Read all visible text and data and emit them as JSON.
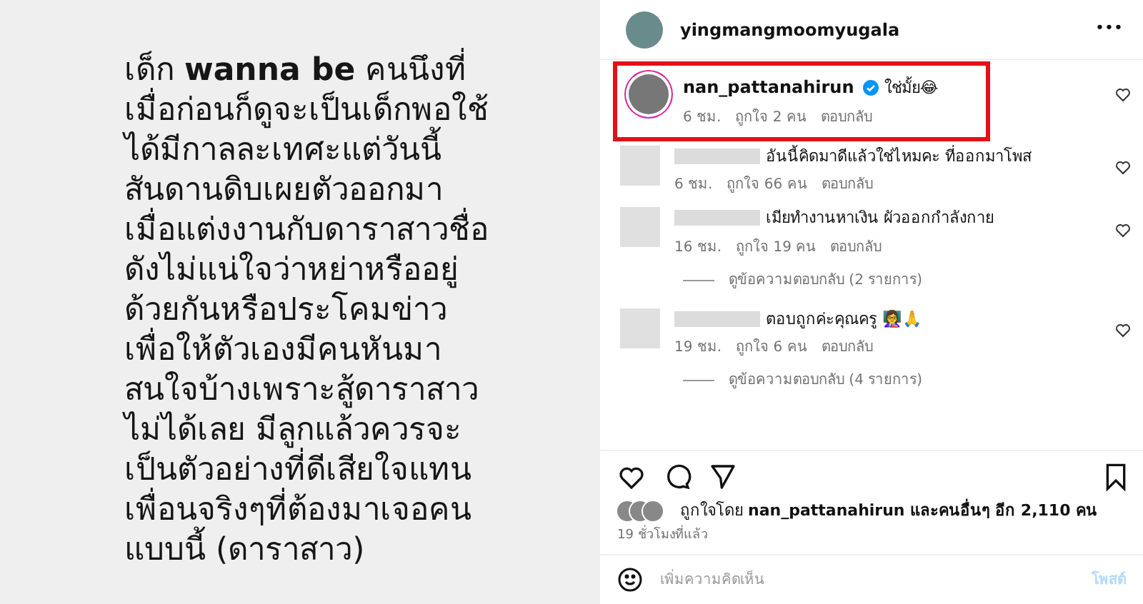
{
  "story": {
    "lines": [
      "เด็ก **wanna be** คนนึงที่",
      "เมื่อก่อนก็ดูจะเป็นเด็กพอใช้",
      "ได้มีกาลละเทศะแต่วันนี้",
      "สันดานดิบเผยตัวออกมา",
      "เมื่อแต่งงานกับดาราสาวชื่อ",
      "ดังไม่แน่ใจว่าหย่าหรืออยู่",
      "ด้วยกันหรือประโคมข่าว",
      "เพื่อให้ตัวเองมีคนหันมา",
      "สนใจบ้างเพราะสู้ดาราสาว",
      "ไม่ได้เลย มีลูกแล้วควรจะ",
      "เป็นตัวอย่างที่ดีเสียใจแทน",
      "เพื่อนจริงๆที่ต้องมาเจอคน",
      "แบบนี้ (ดาราสาว)"
    ]
  },
  "post_header": {
    "username": "yingmangmoomyugala",
    "menu": "•••"
  },
  "comments": [
    {
      "kind": "comment",
      "highlighted": true,
      "username": "nan_pattanahirun",
      "verified": true,
      "blurred": false,
      "text": "ใช่มั้ย😂",
      "time": "6 ชม.",
      "likes": "ถูกใจ 2 คน",
      "reply": "ตอบกลับ"
    },
    {
      "kind": "comment",
      "highlighted": false,
      "blurred": true,
      "text": "อันนี้คิดมาดีแล้วใช่ไหมคะ ที่ออกมาโพส",
      "time": "6 ชม.",
      "likes": "ถูกใจ 66 คน",
      "reply": "ตอบกลับ"
    },
    {
      "kind": "comment",
      "highlighted": false,
      "blurred": true,
      "text": "เมียทำงานหาเงิน ผัวออกกำลังกาย",
      "time": "16 ชม.",
      "likes": "ถูกใจ 19 คน",
      "reply": "ตอบกลับ"
    },
    {
      "kind": "replies",
      "text": "ดูข้อความตอบกลับ (2 รายการ)"
    },
    {
      "kind": "comment",
      "highlighted": false,
      "blurred": true,
      "text": "ตอบถูกค่ะคุณครู 👩‍🏫🙏",
      "time": "19 ชม.",
      "likes": "ถูกใจ 6 คน",
      "reply": "ตอบกลับ"
    },
    {
      "kind": "replies",
      "text": "ดูข้อความตอบกลับ (4 รายการ)"
    }
  ],
  "likes_line": "ถูกใจโดย **nan_pattanahirun** **และคนอื่นๆ อีก 2,110 คน**",
  "post_time": "19 ชั่วโมงที่แล้ว",
  "comment_box": {
    "placeholder": "เพิ่มความคิดเห็น",
    "post_button": "โพสต์",
    "post_disabled": true
  }
}
